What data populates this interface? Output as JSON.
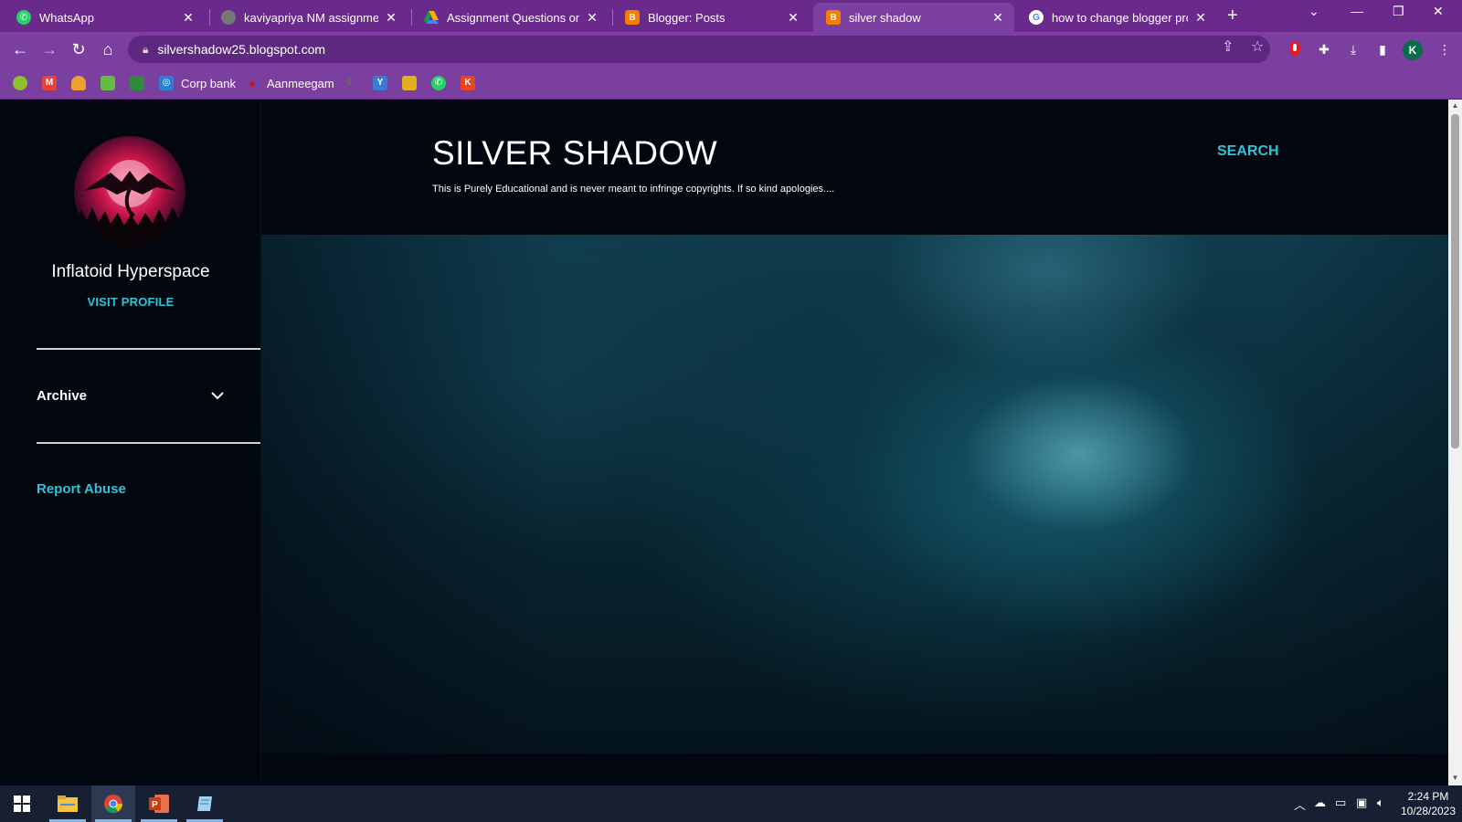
{
  "browser": {
    "tabs": [
      {
        "title": "WhatsApp",
        "icon": "whatsapp-icon",
        "color": "#25d366"
      },
      {
        "title": "kaviyapriya NM assignment c",
        "icon": "globe-icon",
        "color": "#777777"
      },
      {
        "title": "Assignment Questions on Di",
        "icon": "google-drive-icon",
        "color": "#f4b400"
      },
      {
        "title": "Blogger: Posts",
        "icon": "blogger-icon",
        "color": "#f57d00"
      },
      {
        "title": "silver shadow",
        "icon": "blogger-icon",
        "color": "#f57d00"
      },
      {
        "title": "how to change blogger profi",
        "icon": "google-icon",
        "color": "#4285f4"
      }
    ],
    "active_tab_index": 4,
    "url": "silvershadow25.blogspot.com",
    "profile_initial": "K",
    "bookmarks": [
      {
        "label": "",
        "icon": "bookmark-icon-1",
        "color": "#8fbf2f"
      },
      {
        "label": "",
        "icon": "gmail-icon",
        "color": "#ea4335"
      },
      {
        "label": "",
        "icon": "bookmark-icon-3",
        "color": "#f0a030"
      },
      {
        "label": "",
        "icon": "bookmark-icon-4",
        "color": "#66bb44"
      },
      {
        "label": "",
        "icon": "bookmark-icon-5",
        "color": "#2e8b3a"
      },
      {
        "label": "Corp bank",
        "icon": "corp-bank-icon",
        "color": "#2a7fd4"
      },
      {
        "label": "Aanmeegam",
        "icon": "aanmeegam-icon",
        "color": "#c0182b"
      },
      {
        "label": "",
        "icon": "bookmark-icon-8",
        "color": "#5aa02c"
      },
      {
        "label": "",
        "icon": "bookmark-icon-9",
        "color": "#3a7bd5"
      },
      {
        "label": "",
        "icon": "bookmark-icon-10",
        "color": "#e0b020"
      },
      {
        "label": "",
        "icon": "whatsapp-icon",
        "color": "#25d366"
      },
      {
        "label": "",
        "icon": "k-icon",
        "color": "#e8451e"
      }
    ]
  },
  "blog": {
    "title": "SILVER SHADOW",
    "description": "This is Purely Educational and is never meant to infringe copyrights. If so kind apologies....",
    "search_label": "SEARCH",
    "accent_color": "#33c3d6"
  },
  "sidebar": {
    "author_name": "Inflatoid Hyperspace",
    "visit_profile": "VISIT PROFILE",
    "archive_label": "Archive",
    "report_abuse": "Report Abuse"
  },
  "taskbar": {
    "time": "2:24 PM",
    "date": "10/28/2023",
    "apps": [
      "windows-start-icon",
      "file-explorer-icon",
      "chrome-icon",
      "powerpoint-icon",
      "notepad-icon"
    ]
  }
}
